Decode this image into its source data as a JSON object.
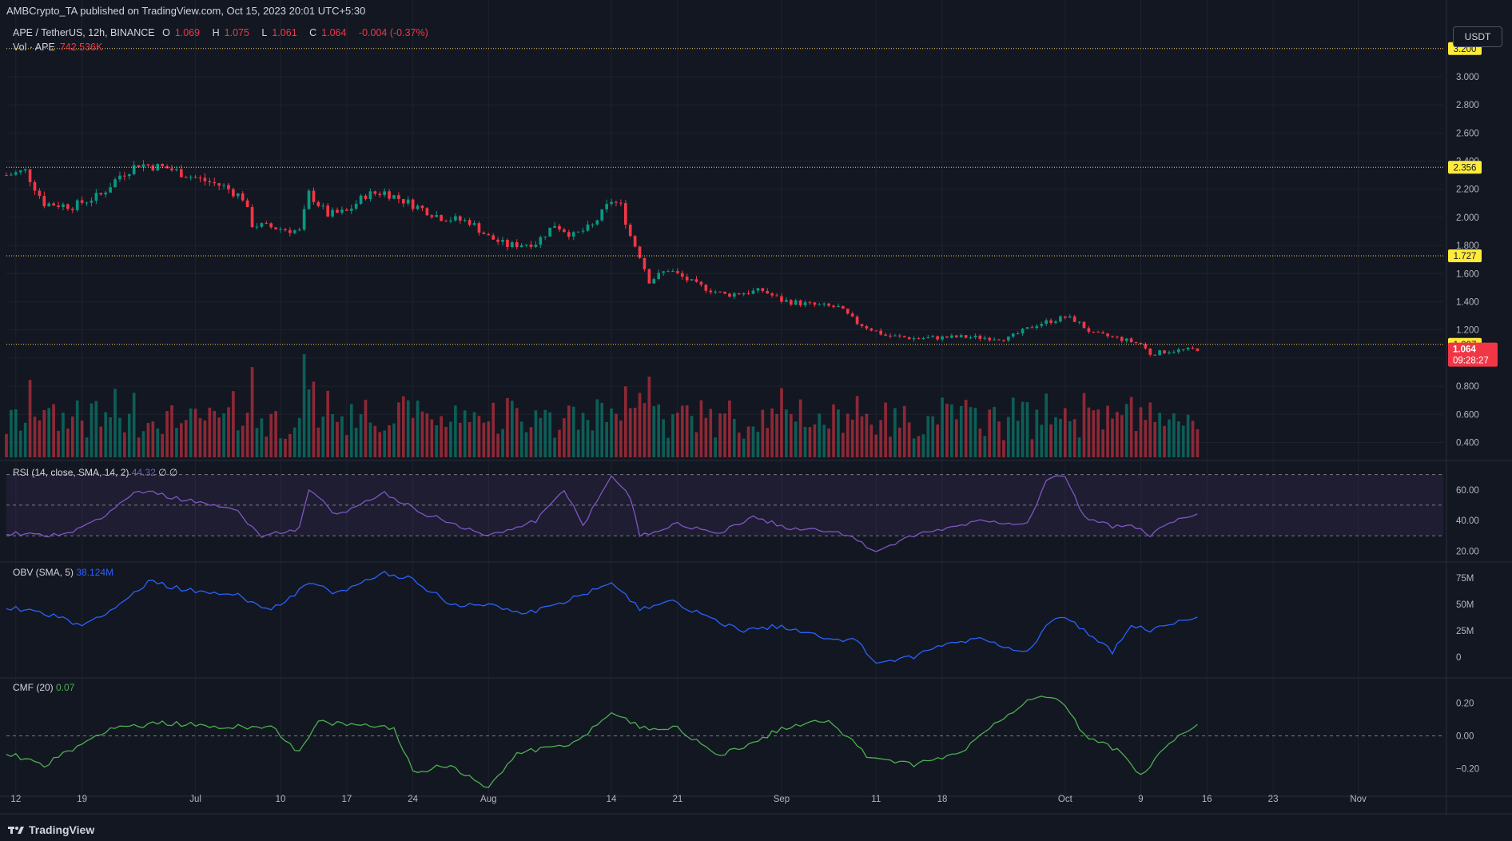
{
  "header": {
    "publisher_line": "AMBCrypto_TA published on TradingView.com, Oct 15, 2023 20:01 UTC+5:30"
  },
  "legend": {
    "symbol": "APE / TetherUS, 12h, BINANCE",
    "o_label": "O",
    "o": "1.069",
    "h_label": "H",
    "h": "1.075",
    "l_label": "L",
    "l": "1.061",
    "c_label": "C",
    "c": "1.064",
    "change": "-0.004 (-0.37%)",
    "vol_label": "Vol · APE",
    "vol": "742.536K"
  },
  "currency_button": "USDT",
  "indicators": {
    "rsi": {
      "label": "RSI (14, close, SMA, 14, 2)",
      "value": "44.32",
      "extra": "∅ ∅"
    },
    "obv": {
      "label": "OBV (SMA, 5)",
      "value": "38.124M"
    },
    "cmf": {
      "label": "CMF (20)",
      "value": "0.07"
    }
  },
  "footer": {
    "brand": "TradingView"
  },
  "colors": {
    "background": "#131722",
    "up": "#089981",
    "down": "#f23645",
    "level_line": "#f0d060",
    "level_label": "#ffeb3b",
    "rsi": "#7e57c2",
    "obv": "#2962ff",
    "cmf": "#4caf50"
  },
  "chart_data": {
    "type": "candlestick",
    "price_axis": {
      "ticks": [
        3.0,
        2.8,
        2.6,
        2.4,
        2.2,
        2.0,
        1.8,
        1.6,
        1.4,
        1.2,
        1.0,
        0.8,
        0.6,
        0.4
      ],
      "tick_labels": [
        "3.000",
        "2.800",
        "2.600",
        "2.400",
        "2.200",
        "2.000",
        "1.800",
        "1.600",
        "1.400",
        "1.200",
        "1.000",
        "0.800",
        "0.600",
        "0.400"
      ],
      "range": [
        0.34,
        3.25
      ]
    },
    "levels": [
      {
        "value": 3.2,
        "label": "3.200"
      },
      {
        "value": 2.356,
        "label": "2.356"
      },
      {
        "value": 1.727,
        "label": "1.727"
      },
      {
        "value": 1.097,
        "label": "1.097"
      }
    ],
    "last_price": {
      "value": 1.064,
      "label": "1.064",
      "countdown": "09:28:27"
    },
    "x_axis": {
      "tick_labels": [
        "12",
        "19",
        "Jul",
        "10",
        "17",
        "24",
        "Aug",
        "14",
        "21",
        "Sep",
        "11",
        "18",
        "Oct",
        "9",
        "16",
        "23",
        "Nov"
      ],
      "tick_dates": [
        "2023-06-12",
        "2023-06-19",
        "2023-07-01",
        "2023-07-10",
        "2023-07-17",
        "2023-07-24",
        "2023-08-01",
        "2023-08-14",
        "2023-08-21",
        "2023-09-01",
        "2023-09-11",
        "2023-09-18",
        "2023-10-01",
        "2023-10-09",
        "2023-10-16",
        "2023-10-23",
        "2023-11-01"
      ],
      "range": [
        "2023-06-11",
        "2023-11-10"
      ]
    },
    "close_anchors": [
      [
        "2023-06-11",
        2.3
      ],
      [
        "2023-06-13",
        2.33
      ],
      [
        "2023-06-15",
        2.1
      ],
      [
        "2023-06-18",
        2.08
      ],
      [
        "2023-06-21",
        2.16
      ],
      [
        "2023-06-23",
        2.3
      ],
      [
        "2023-06-25",
        2.38
      ],
      [
        "2023-06-28",
        2.35
      ],
      [
        "2023-07-01",
        2.28
      ],
      [
        "2023-07-04",
        2.22
      ],
      [
        "2023-07-06",
        2.14
      ],
      [
        "2023-07-07",
        1.95
      ],
      [
        "2023-07-10",
        1.92
      ],
      [
        "2023-07-12",
        1.9
      ],
      [
        "2023-07-13",
        2.17
      ],
      [
        "2023-07-15",
        2.02
      ],
      [
        "2023-07-17",
        2.04
      ],
      [
        "2023-07-19",
        2.16
      ],
      [
        "2023-07-21",
        2.18
      ],
      [
        "2023-07-24",
        2.09
      ],
      [
        "2023-07-27",
        2.0
      ],
      [
        "2023-07-30",
        1.97
      ],
      [
        "2023-08-01",
        1.86
      ],
      [
        "2023-08-03",
        1.8
      ],
      [
        "2023-08-06",
        1.82
      ],
      [
        "2023-08-08",
        1.95
      ],
      [
        "2023-08-10",
        1.87
      ],
      [
        "2023-08-12",
        1.94
      ],
      [
        "2023-08-14",
        2.12
      ],
      [
        "2023-08-15",
        2.08
      ],
      [
        "2023-08-16",
        1.87
      ],
      [
        "2023-08-17",
        1.73
      ],
      [
        "2023-08-18",
        1.55
      ],
      [
        "2023-08-20",
        1.63
      ],
      [
        "2023-08-23",
        1.52
      ],
      [
        "2023-08-26",
        1.45
      ],
      [
        "2023-08-30",
        1.48
      ],
      [
        "2023-09-01",
        1.41
      ],
      [
        "2023-09-04",
        1.38
      ],
      [
        "2023-09-07",
        1.36
      ],
      [
        "2023-09-09",
        1.25
      ],
      [
        "2023-09-12",
        1.16
      ],
      [
        "2023-09-15",
        1.14
      ],
      [
        "2023-09-20",
        1.15
      ],
      [
        "2023-09-25",
        1.14
      ],
      [
        "2023-09-28",
        1.24
      ],
      [
        "2023-10-01",
        1.29
      ],
      [
        "2023-10-02",
        1.27
      ],
      [
        "2023-10-04",
        1.17
      ],
      [
        "2023-10-06",
        1.15
      ],
      [
        "2023-10-09",
        1.1
      ],
      [
        "2023-10-10",
        1.03
      ],
      [
        "2023-10-12",
        1.05
      ],
      [
        "2023-10-15",
        1.064
      ]
    ],
    "volume_note": "volume histogram below price pane, colored by candle direction",
    "rsi_axis": {
      "ticks": [
        60,
        40,
        20
      ],
      "tick_labels": [
        "60.00",
        "40.00",
        "20.00"
      ],
      "bands": [
        70,
        50,
        30
      ],
      "range": [
        16,
        74
      ]
    },
    "rsi_anchors": [
      [
        "2023-06-11",
        32
      ],
      [
        "2023-06-17",
        30
      ],
      [
        "2023-06-21",
        42
      ],
      [
        "2023-06-25",
        60
      ],
      [
        "2023-07-01",
        52
      ],
      [
        "2023-07-05",
        48
      ],
      [
        "2023-07-08",
        30
      ],
      [
        "2023-07-12",
        35
      ],
      [
        "2023-07-13",
        60
      ],
      [
        "2023-07-16",
        43
      ],
      [
        "2023-07-21",
        58
      ],
      [
        "2023-07-25",
        45
      ],
      [
        "2023-08-01",
        30
      ],
      [
        "2023-08-06",
        40
      ],
      [
        "2023-08-09",
        60
      ],
      [
        "2023-08-11",
        37
      ],
      [
        "2023-08-14",
        70
      ],
      [
        "2023-08-16",
        55
      ],
      [
        "2023-08-17",
        30
      ],
      [
        "2023-08-21",
        38
      ],
      [
        "2023-08-25",
        31
      ],
      [
        "2023-08-29",
        42
      ],
      [
        "2023-09-02",
        35
      ],
      [
        "2023-09-07",
        33
      ],
      [
        "2023-09-11",
        20
      ],
      [
        "2023-09-15",
        30
      ],
      [
        "2023-09-22",
        40
      ],
      [
        "2023-09-27",
        38
      ],
      [
        "2023-09-29",
        66
      ],
      [
        "2023-10-01",
        70
      ],
      [
        "2023-10-03",
        42
      ],
      [
        "2023-10-06",
        36
      ],
      [
        "2023-10-08",
        37
      ],
      [
        "2023-10-10",
        30
      ],
      [
        "2023-10-12",
        38
      ],
      [
        "2023-10-15",
        44.32
      ]
    ],
    "obv_axis": {
      "ticks": [
        75,
        50,
        25,
        0
      ],
      "tick_labels": [
        "75M",
        "50M",
        "25M",
        "0"
      ],
      "range": [
        -15,
        85
      ]
    },
    "obv_anchors": [
      [
        "2023-06-11",
        48
      ],
      [
        "2023-06-15",
        42
      ],
      [
        "2023-06-19",
        30
      ],
      [
        "2023-06-23",
        50
      ],
      [
        "2023-06-26",
        72
      ],
      [
        "2023-07-01",
        62
      ],
      [
        "2023-07-05",
        60
      ],
      [
        "2023-07-09",
        45
      ],
      [
        "2023-07-13",
        70
      ],
      [
        "2023-07-16",
        60
      ],
      [
        "2023-07-21",
        80
      ],
      [
        "2023-07-24",
        74
      ],
      [
        "2023-07-28",
        50
      ],
      [
        "2023-08-01",
        50
      ],
      [
        "2023-08-05",
        42
      ],
      [
        "2023-08-09",
        52
      ],
      [
        "2023-08-14",
        72
      ],
      [
        "2023-08-17",
        45
      ],
      [
        "2023-08-20",
        55
      ],
      [
        "2023-08-24",
        38
      ],
      [
        "2023-08-28",
        25
      ],
      [
        "2023-09-01",
        30
      ],
      [
        "2023-09-05",
        20
      ],
      [
        "2023-09-09",
        15
      ],
      [
        "2023-09-11",
        -5
      ],
      [
        "2023-09-15",
        0
      ],
      [
        "2023-09-18",
        12
      ],
      [
        "2023-09-22",
        18
      ],
      [
        "2023-09-27",
        5
      ],
      [
        "2023-09-29",
        30
      ],
      [
        "2023-10-01",
        40
      ],
      [
        "2023-10-03",
        25
      ],
      [
        "2023-10-06",
        5
      ],
      [
        "2023-10-08",
        30
      ],
      [
        "2023-10-10",
        25
      ],
      [
        "2023-10-15",
        38.124
      ]
    ],
    "cmf_axis": {
      "ticks": [
        0.2,
        0.0,
        -0.2
      ],
      "tick_labels": [
        "0.20",
        "0.00",
        "−0.20"
      ],
      "range": [
        -0.34,
        0.32
      ]
    },
    "cmf_anchors": [
      [
        "2023-06-11",
        -0.1
      ],
      [
        "2023-06-15",
        -0.18
      ],
      [
        "2023-06-19",
        -0.05
      ],
      [
        "2023-06-22",
        0.05
      ],
      [
        "2023-06-28",
        0.08
      ],
      [
        "2023-07-04",
        0.05
      ],
      [
        "2023-07-09",
        0.06
      ],
      [
        "2023-07-12",
        -0.1
      ],
      [
        "2023-07-14",
        0.08
      ],
      [
        "2023-07-22",
        0.05
      ],
      [
        "2023-07-24",
        -0.22
      ],
      [
        "2023-07-28",
        -0.18
      ],
      [
        "2023-08-01",
        -0.32
      ],
      [
        "2023-08-04",
        -0.1
      ],
      [
        "2023-08-10",
        -0.05
      ],
      [
        "2023-08-14",
        0.15
      ],
      [
        "2023-08-17",
        0.05
      ],
      [
        "2023-08-21",
        0.05
      ],
      [
        "2023-08-25",
        -0.12
      ],
      [
        "2023-08-29",
        -0.05
      ],
      [
        "2023-09-01",
        0.05
      ],
      [
        "2023-09-06",
        0.1
      ],
      [
        "2023-09-10",
        -0.12
      ],
      [
        "2023-09-15",
        -0.18
      ],
      [
        "2023-09-20",
        -0.1
      ],
      [
        "2023-09-24",
        0.1
      ],
      [
        "2023-09-28",
        0.25
      ],
      [
        "2023-10-01",
        0.2
      ],
      [
        "2023-10-03",
        0.0
      ],
      [
        "2023-10-07",
        -0.1
      ],
      [
        "2023-10-09",
        -0.25
      ],
      [
        "2023-10-12",
        -0.05
      ],
      [
        "2023-10-15",
        0.07
      ]
    ]
  }
}
